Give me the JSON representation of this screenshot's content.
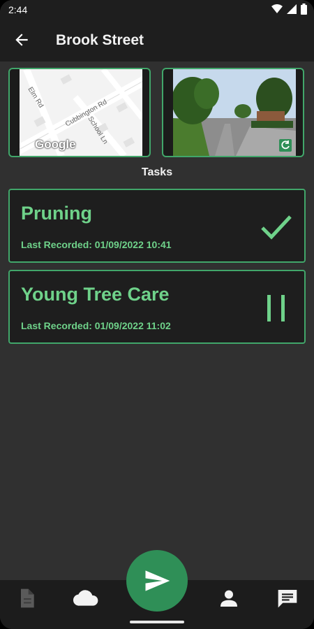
{
  "status_bar": {
    "time": "2:44"
  },
  "app_bar": {
    "title": "Brook Street",
    "back_icon": "arrow-back-icon"
  },
  "thumbnails": {
    "map": {
      "label": "Google",
      "streets": [
        "Elm Rd",
        "Cubbington Rd",
        "School Ln"
      ]
    },
    "street_view": {
      "icon": "refresh-icon"
    }
  },
  "tasks_title": "Tasks",
  "tasks": [
    {
      "name": "Pruning",
      "last_recorded": "Last Recorded: 01/09/2022 10:41",
      "status_icon": "check-icon"
    },
    {
      "name": "Young Tree Care",
      "last_recorded": "Last Recorded: 01/09/2022 11:02",
      "status_icon": "pause-icon"
    }
  ],
  "bottom_nav": [
    "document-icon",
    "cloud-icon",
    "send-icon",
    "person-icon",
    "message-icon"
  ],
  "colors": {
    "accent": "#6fd28a",
    "border": "#41a66a",
    "fab": "#2f8f57",
    "background": "#303030",
    "bar": "#1e1e1e"
  }
}
